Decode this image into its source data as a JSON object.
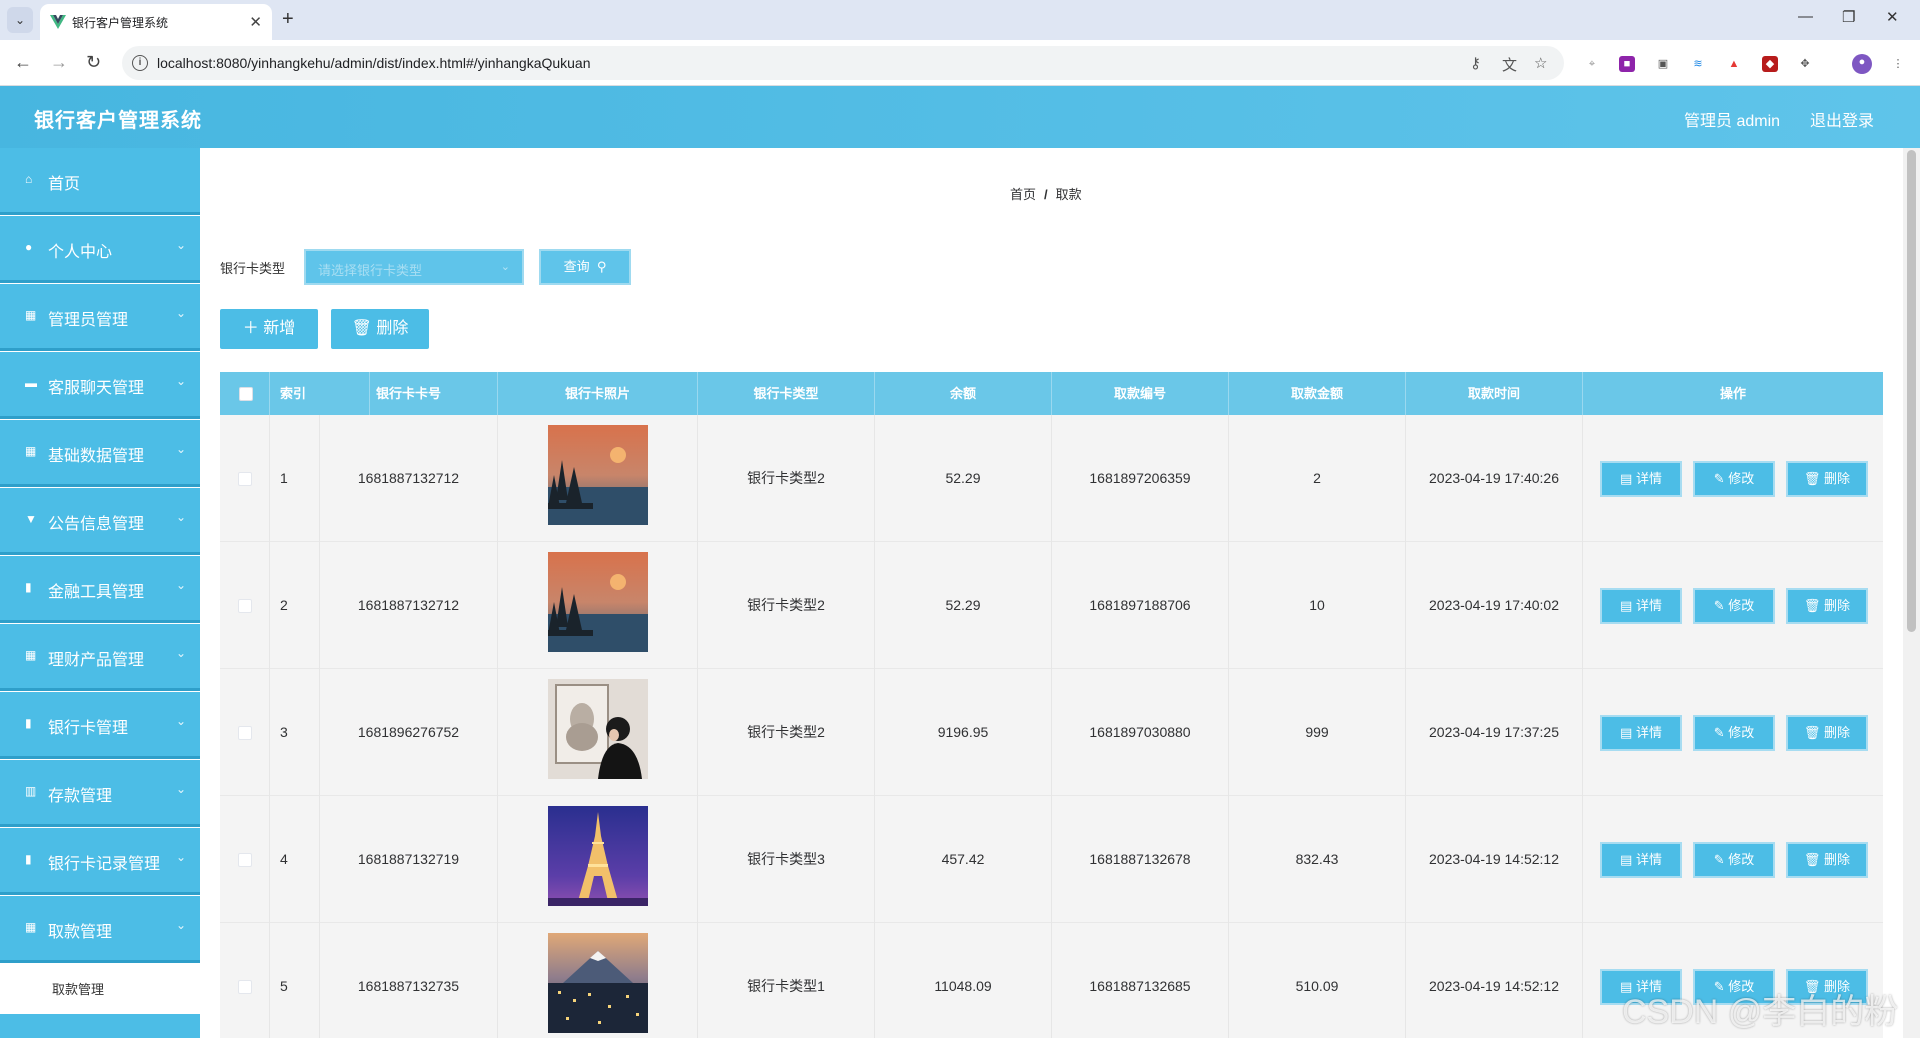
{
  "browser": {
    "tab_title": "银行客户管理系统",
    "url": "localhost:8080/yinhangkehu/admin/dist/index.html#/yinhangkaQukuan"
  },
  "header": {
    "title": "银行客户管理系统",
    "user": "管理员 admin",
    "logout": "退出登录"
  },
  "sidebar": {
    "items": [
      {
        "label": "首页",
        "icon": "home-icon",
        "arrow": false
      },
      {
        "label": "个人中心",
        "icon": "user-icon",
        "arrow": true
      },
      {
        "label": "管理员管理",
        "icon": "grid-icon",
        "arrow": true
      },
      {
        "label": "客服聊天管理",
        "icon": "chat-icon",
        "arrow": true
      },
      {
        "label": "基础数据管理",
        "icon": "grid-icon",
        "arrow": true
      },
      {
        "label": "公告信息管理",
        "icon": "notice-icon",
        "arrow": true
      },
      {
        "label": "金融工具管理",
        "icon": "doc-icon",
        "arrow": true
      },
      {
        "label": "理财产品管理",
        "icon": "grid-icon",
        "arrow": true
      },
      {
        "label": "银行卡管理",
        "icon": "doc-icon",
        "arrow": true
      },
      {
        "label": "存款管理",
        "icon": "chart-icon",
        "arrow": true
      },
      {
        "label": "银行卡记录管理",
        "icon": "doc-icon",
        "arrow": true
      },
      {
        "label": "取款管理",
        "icon": "grid-icon",
        "arrow": true
      }
    ],
    "sub_item": "取款管理"
  },
  "breadcrumb": {
    "home": "首页",
    "sep": "/",
    "current": "取款"
  },
  "search": {
    "label": "银行卡类型",
    "placeholder": "请选择银行卡类型",
    "query": "查询"
  },
  "toolbar": {
    "add": "新增",
    "delete": "删除"
  },
  "table": {
    "headers": [
      "索引",
      "银行卡卡号",
      "银行卡照片",
      "银行卡类型",
      "余额",
      "取款编号",
      "取款金额",
      "取款时间",
      "操作"
    ],
    "actions": {
      "detail": "详情",
      "edit": "修改",
      "delete": "删除"
    },
    "rows": [
      {
        "index": "1",
        "card_no": "1681887132712",
        "card_type": "银行卡类型2",
        "balance": "52.29",
        "withdraw_no": "1681897206359",
        "amount": "2",
        "time": "2023-04-19 17:40:26"
      },
      {
        "index": "2",
        "card_no": "1681887132712",
        "card_type": "银行卡类型2",
        "balance": "52.29",
        "withdraw_no": "1681897188706",
        "amount": "10",
        "time": "2023-04-19 17:40:02"
      },
      {
        "index": "3",
        "card_no": "1681896276752",
        "card_type": "银行卡类型2",
        "balance": "9196.95",
        "withdraw_no": "1681897030880",
        "amount": "999",
        "time": "2023-04-19 17:37:25"
      },
      {
        "index": "4",
        "card_no": "1681887132719",
        "card_type": "银行卡类型3",
        "balance": "457.42",
        "withdraw_no": "1681887132678",
        "amount": "832.43",
        "time": "2023-04-19 14:52:12"
      },
      {
        "index": "5",
        "card_no": "1681887132735",
        "card_type": "银行卡类型1",
        "balance": "11048.09",
        "withdraw_no": "1681887132685",
        "amount": "510.09",
        "time": "2023-04-19 14:52:12"
      }
    ]
  },
  "watermark": "CSDN @李白的粉"
}
